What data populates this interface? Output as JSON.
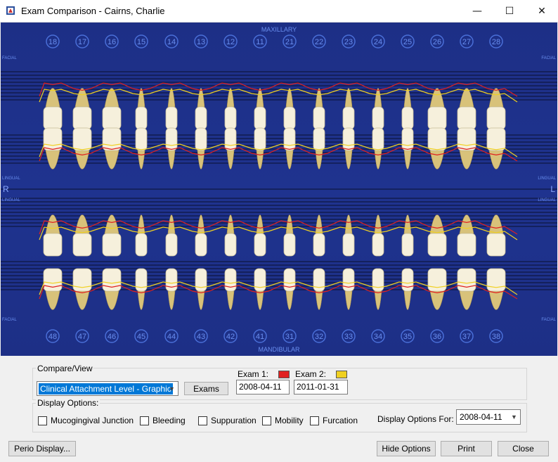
{
  "window": {
    "title": "Exam Comparison -  Cairns, Charlie",
    "minimize_glyph": "—",
    "maximize_glyph": "☐",
    "close_glyph": "✕"
  },
  "chart": {
    "maxillary_label": "MAXILLARY",
    "mandibular_label": "MANDIBULAR",
    "facial_label": "FACIAL",
    "lingual_label": "LINGUAL",
    "right_label": "R",
    "left_label": "L",
    "upper_teeth": [
      "18",
      "17",
      "16",
      "15",
      "14",
      "13",
      "12",
      "11",
      "21",
      "22",
      "23",
      "24",
      "25",
      "26",
      "27",
      "28"
    ],
    "lower_teeth": [
      "48",
      "47",
      "46",
      "45",
      "44",
      "43",
      "42",
      "41",
      "31",
      "32",
      "33",
      "34",
      "35",
      "36",
      "37",
      "38"
    ],
    "exam1_color": "#e02020",
    "exam2_color": "#f0d020",
    "background": "#1f338f"
  },
  "compare_view": {
    "group_label": "Compare/View",
    "selected_view": "Clinical Attachment Level - Graphic",
    "exams_button": "Exams",
    "exam1_label": "Exam 1:",
    "exam2_label": "Exam 2:",
    "exam1_date": "2008-04-11",
    "exam2_date": "2011-01-31"
  },
  "display_options": {
    "group_label": "Display Options:",
    "mucogingival": "Mucogingival Junction",
    "bleeding": "Bleeding",
    "suppuration": "Suppuration",
    "mobility": "Mobility",
    "furcation": "Furcation",
    "for_label": "Display Options For:",
    "for_value": "2008-04-11"
  },
  "footer": {
    "perio_display": "Perio Display...",
    "hide_options": "Hide Options",
    "print": "Print",
    "close": "Close"
  }
}
